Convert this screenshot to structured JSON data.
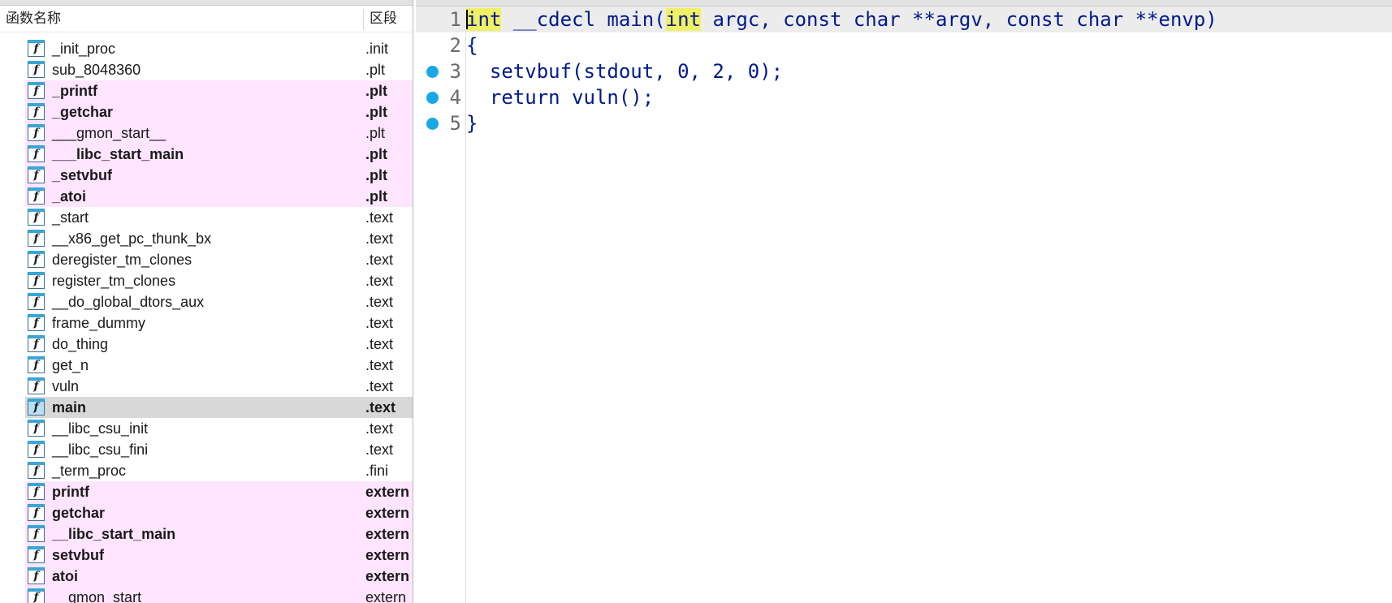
{
  "function_list": {
    "header": {
      "name_col": "函数名称",
      "segment_col": "区段"
    },
    "icon_glyph": "f",
    "rows": [
      {
        "name": "_init_proc",
        "segment": ".init",
        "kind": "normal"
      },
      {
        "name": "sub_8048360",
        "segment": ".plt",
        "kind": "normal"
      },
      {
        "name": "_printf",
        "segment": ".plt",
        "kind": "import-bold"
      },
      {
        "name": "_getchar",
        "segment": ".plt",
        "kind": "import-bold"
      },
      {
        "name": "___gmon_start__",
        "segment": ".plt",
        "kind": "import"
      },
      {
        "name": "___libc_start_main",
        "segment": ".plt",
        "kind": "import-bold"
      },
      {
        "name": "_setvbuf",
        "segment": ".plt",
        "kind": "import-bold"
      },
      {
        "name": "_atoi",
        "segment": ".plt",
        "kind": "import-bold"
      },
      {
        "name": "_start",
        "segment": ".text",
        "kind": "normal"
      },
      {
        "name": "__x86_get_pc_thunk_bx",
        "segment": ".text",
        "kind": "normal"
      },
      {
        "name": "deregister_tm_clones",
        "segment": ".text",
        "kind": "normal"
      },
      {
        "name": "register_tm_clones",
        "segment": ".text",
        "kind": "normal"
      },
      {
        "name": "__do_global_dtors_aux",
        "segment": ".text",
        "kind": "normal"
      },
      {
        "name": "frame_dummy",
        "segment": ".text",
        "kind": "normal"
      },
      {
        "name": "do_thing",
        "segment": ".text",
        "kind": "normal"
      },
      {
        "name": "get_n",
        "segment": ".text",
        "kind": "normal"
      },
      {
        "name": "vuln",
        "segment": ".text",
        "kind": "normal"
      },
      {
        "name": "main",
        "segment": ".text",
        "kind": "selected"
      },
      {
        "name": "__libc_csu_init",
        "segment": ".text",
        "kind": "normal"
      },
      {
        "name": "__libc_csu_fini",
        "segment": ".text",
        "kind": "normal"
      },
      {
        "name": "_term_proc",
        "segment": ".fini",
        "kind": "normal"
      },
      {
        "name": "printf",
        "segment": "extern",
        "kind": "import-bold"
      },
      {
        "name": "getchar",
        "segment": "extern",
        "kind": "import-bold"
      },
      {
        "name": "__libc_start_main",
        "segment": "extern",
        "kind": "import-bold"
      },
      {
        "name": "setvbuf",
        "segment": "extern",
        "kind": "import-bold"
      },
      {
        "name": "atoi",
        "segment": "extern",
        "kind": "import-bold"
      },
      {
        "name": "__gmon_start__",
        "segment": "extern",
        "kind": "import"
      }
    ]
  },
  "pseudocode": {
    "lines": [
      {
        "num": "1",
        "parts": [
          {
            "text": "int",
            "hl": true
          },
          {
            "text": " __cdecl main(",
            "hl": false
          },
          {
            "text": "int",
            "hl": true
          },
          {
            "text": " argc, const char **argv, const char **envp)",
            "hl": false
          }
        ],
        "breakpoint": false,
        "current": true
      },
      {
        "num": "2",
        "parts": [
          {
            "text": "{",
            "hl": false
          }
        ],
        "breakpoint": false,
        "current": false
      },
      {
        "num": "3",
        "parts": [
          {
            "text": "  setvbuf(stdout, 0, 2, 0);",
            "hl": false
          }
        ],
        "breakpoint": true,
        "current": false
      },
      {
        "num": "4",
        "parts": [
          {
            "text": "  return vuln();",
            "hl": false
          }
        ],
        "breakpoint": true,
        "current": false
      },
      {
        "num": "5",
        "parts": [
          {
            "text": "}",
            "hl": false
          }
        ],
        "breakpoint": true,
        "current": false
      }
    ]
  },
  "colors": {
    "import_row_bg": "#ffe5ff",
    "selected_row_bg": "#d8d8d8",
    "keyword_highlight": "#f0f064",
    "code_text": "#001a8c",
    "breakpoint": "#18a8e8"
  }
}
